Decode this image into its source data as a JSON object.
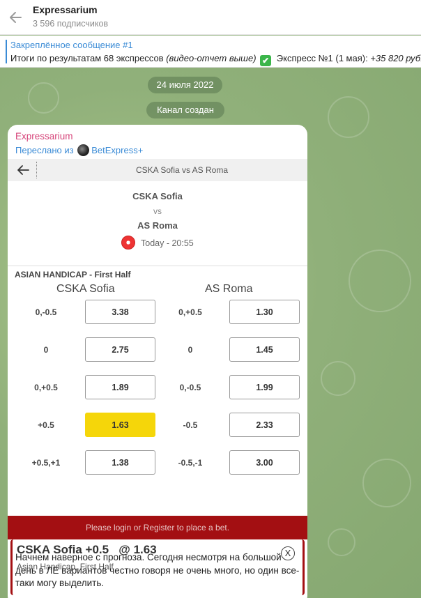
{
  "header": {
    "channel_name": "Expressarium",
    "subscribers": "3 596 подписчиков"
  },
  "pinned": {
    "title": "Закреплённое сообщение #1",
    "text_main": "Итоги по результатам 68 экспрессов ",
    "text_italic": "(видео-отчет выше)",
    "text_after": " Экспресс №1 (1 мая): ",
    "text_italic2": "+35 820 руб.",
    "check_icon": "✔"
  },
  "service": {
    "date": "24 июля 2022",
    "created": "Канал создан"
  },
  "message": {
    "author": "Expressarium",
    "forwarded_prefix": "Переслано из",
    "forwarded_source": "BetExpress+",
    "text": "Начнем наверное с прогноза. Сегодня несмотря на большой день в ЛЕ вариантов честно говоря не очень много, но один все-таки могу выделить."
  },
  "betscreen": {
    "title": "CSKA Sofia vs AS Roma",
    "team_home": "CSKA Sofia",
    "vs": "vs",
    "team_away": "AS Roma",
    "time": "Today - 20:55",
    "market": "ASIAN HANDICAP - First Half",
    "col_home": "CSKA Sofia",
    "col_away": "AS Roma",
    "rows": [
      {
        "h1": "0,-0.5",
        "o1": "3.38",
        "h2": "0,+0.5",
        "o2": "1.30"
      },
      {
        "h1": "0",
        "o1": "2.75",
        "h2": "0",
        "o2": "1.45"
      },
      {
        "h1": "0,+0.5",
        "o1": "1.89",
        "h2": "0,-0.5",
        "o2": "1.99"
      },
      {
        "h1": "+0.5",
        "o1": "1.63",
        "h2": "-0.5",
        "o2": "2.33"
      },
      {
        "h1": "+0.5,+1",
        "o1": "1.38",
        "h2": "-0.5,-1",
        "o2": "3.00"
      }
    ],
    "selected_odd": "1.63",
    "login_text": "Please login or Register to place a bet.",
    "slip_title": "CSKA Sofia +0.5   @ 1.63",
    "slip_sub": "Asian Handicap, First Half",
    "slip_close": "X"
  },
  "colors": {
    "link": "#3a8bd6",
    "author": "#d6457a",
    "selected": "#f5d60a",
    "bet_bar": "#a30f12"
  }
}
